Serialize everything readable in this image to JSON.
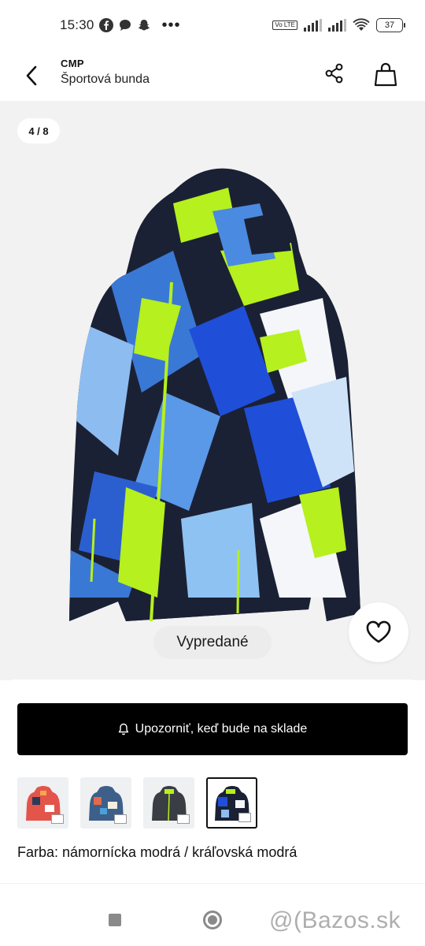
{
  "status": {
    "time": "15:30",
    "dots": "•••",
    "volte": "Vo LTE",
    "battery": "37"
  },
  "header": {
    "brand": "CMP",
    "title": "Športová bunda"
  },
  "gallery": {
    "counter": "4 / 8",
    "badge": "Vypredané"
  },
  "sheet": {
    "notify_label": "Upozorniť, keď bude na sklade",
    "color_line": "Farba: námornícka modrá / kráľovská modrá",
    "variants": [
      {
        "name": "red-multicolor",
        "active": false
      },
      {
        "name": "multicolor",
        "active": false
      },
      {
        "name": "dark-grey",
        "active": false
      },
      {
        "name": "navy-royal-blue",
        "active": true
      }
    ]
  },
  "watermark": "@(Bazos.sk",
  "colors": {
    "accent": "#000000",
    "lime": "#b6f01e",
    "royal": "#1f4fd8",
    "navy": "#1b2134"
  },
  "icons": [
    "facebook-icon",
    "chat-icon",
    "snapchat-icon",
    "wifi-icon",
    "signal-icon",
    "battery-icon",
    "back-icon",
    "share-icon",
    "shopping-bag-icon",
    "heart-icon",
    "bell-icon"
  ]
}
